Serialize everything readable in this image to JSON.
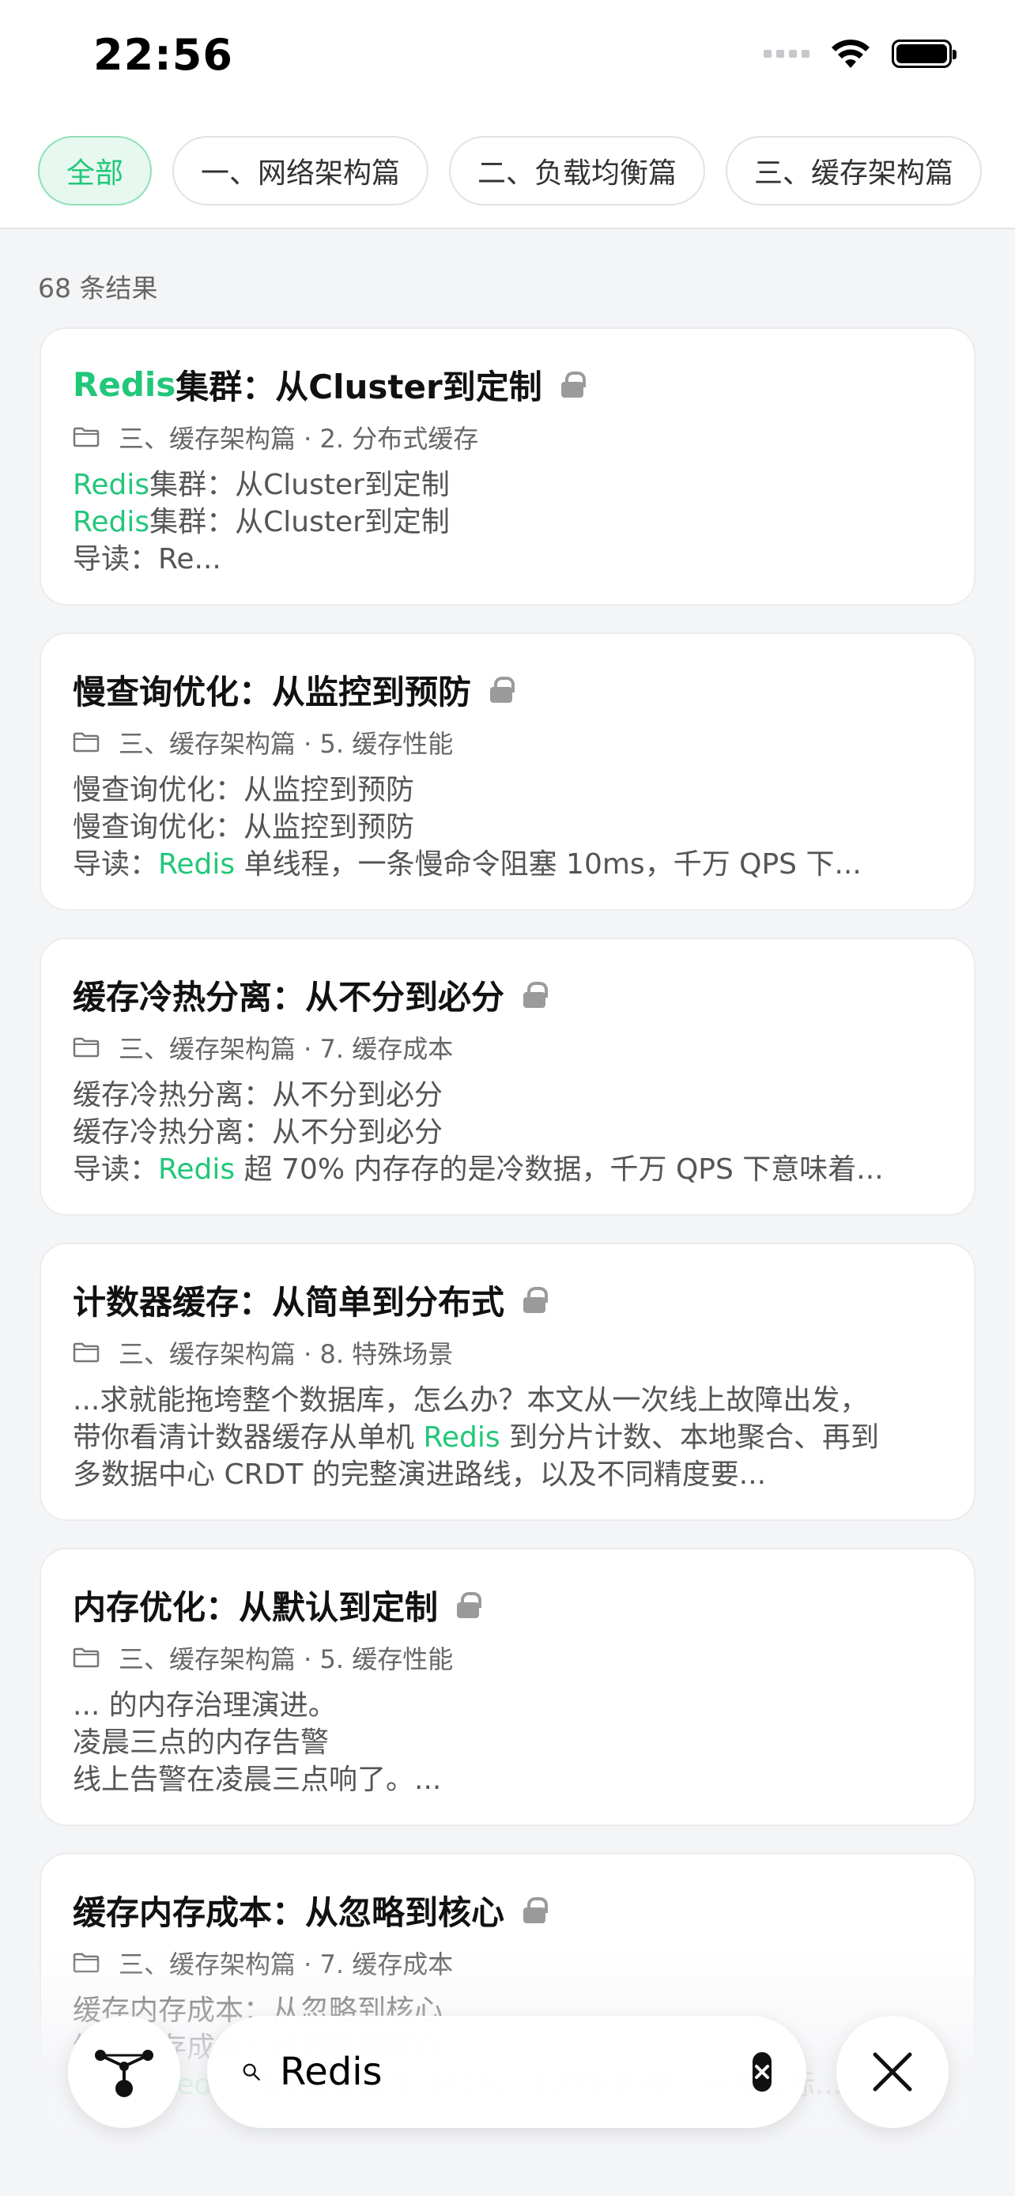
{
  "status": {
    "time": "22:56"
  },
  "filters": {
    "chips": [
      {
        "label": "全部",
        "active": true
      },
      {
        "label": "一、网络架构篇",
        "active": false
      },
      {
        "label": "二、负载均衡篇",
        "active": false
      },
      {
        "label": "三、缓存架构篇",
        "active": false
      }
    ]
  },
  "results": {
    "count_label": "68 条结果",
    "items": [
      {
        "title_hl": "Redis",
        "title_rest": "集群：从Cluster到定制",
        "meta": "三、缓存架构篇 · 2. 分布式缓存",
        "lines": [
          {
            "hl": "Redis",
            "rest": "集群：从Cluster到定制"
          },
          {
            "hl": "Redis",
            "rest": "集群：从Cluster到定制"
          },
          {
            "pre": "导读：Re..."
          }
        ]
      },
      {
        "title_hl": "",
        "title_rest": "慢查询优化：从监控到预防",
        "meta": "三、缓存架构篇 · 5. 缓存性能",
        "lines": [
          {
            "pre": "慢查询优化：从监控到预防"
          },
          {
            "pre": "慢查询优化：从监控到预防"
          },
          {
            "pre": "导读：",
            "hl": "Redis",
            "rest": " 单线程，一条慢命令阻塞 10ms，千万 QPS 下..."
          }
        ]
      },
      {
        "title_hl": "",
        "title_rest": "缓存冷热分离：从不分到必分",
        "meta": "三、缓存架构篇 · 7. 缓存成本",
        "lines": [
          {
            "pre": "缓存冷热分离：从不分到必分"
          },
          {
            "pre": "缓存冷热分离：从不分到必分"
          },
          {
            "pre": "导读：",
            "hl": "Redis",
            "rest": " 超 70% 内存存的是冷数据，千万 QPS 下意味着..."
          }
        ]
      },
      {
        "title_hl": "",
        "title_rest": "计数器缓存：从简单到分布式",
        "meta": "三、缓存架构篇 · 8. 特殊场景",
        "lines": [
          {
            "pre": "...求就能拖垮整个数据库，怎么办？本文从一次线上故障出发，"
          },
          {
            "pre": "带你看清计数器缓存从单机 ",
            "hl": "Redis",
            "rest": " 到分片计数、本地聚合、再到"
          },
          {
            "pre": "多数据中心 CRDT 的完整演进路线，以及不同精度要..."
          }
        ]
      },
      {
        "title_hl": "",
        "title_rest": "内存优化：从默认到定制",
        "meta": "三、缓存架构篇 · 5. 缓存性能",
        "lines": [
          {
            "pre": "... 的内存治理演进。"
          },
          {
            "pre": "凌晨三点的内存告警"
          },
          {
            "pre": "线上告警在凌晨三点响了。..."
          }
        ]
      },
      {
        "title_hl": "",
        "title_rest": "缓存内存成本：从忽略到核心",
        "meta": "三、缓存架构篇 · 7. 缓存成本",
        "lines": [
          {
            "pre": "缓存内存成本：从忽略到核心"
          },
          {
            "pre": "缓存内存成本：从忽略到核心"
          },
          {
            "pre": "导读：",
            "hl": "Redis",
            "rest": " 内存成本上涨 340%，12TB 内存，一年之际..."
          }
        ]
      }
    ]
  },
  "search": {
    "value": "Redis"
  },
  "colors": {
    "accent": "#22c77a",
    "chip_active_bg": "#e6f8ef"
  },
  "icons": {
    "graph": "graph-nodes-icon",
    "search": "search-icon",
    "clear": "clear-icon",
    "close": "close-icon",
    "folder": "folder-icon",
    "lock": "lock-icon"
  }
}
